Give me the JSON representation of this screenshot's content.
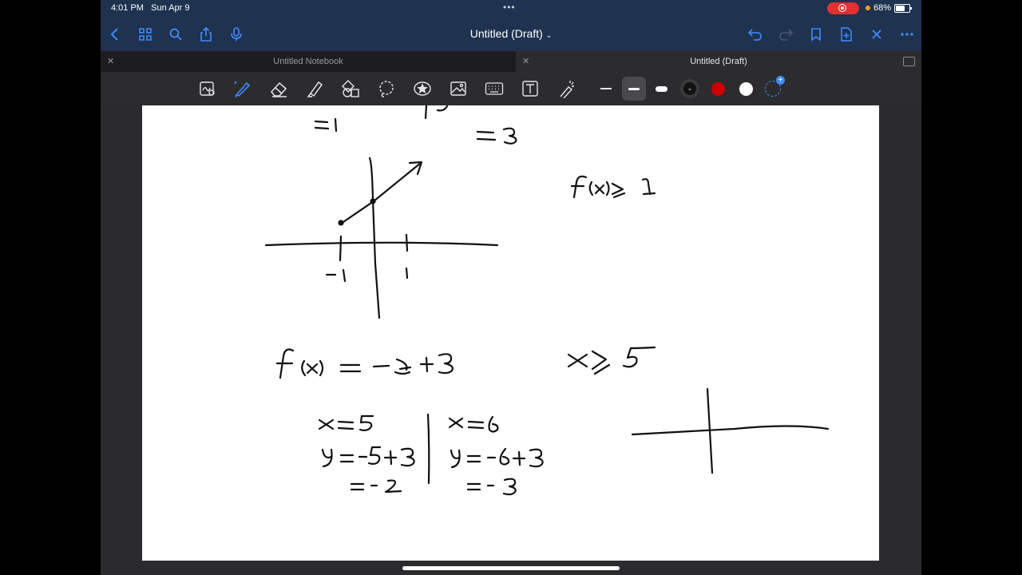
{
  "status_bar": {
    "time": "4:01 PM",
    "date": "Sun Apr 9",
    "battery": "68%"
  },
  "nav": {
    "title": "Untitled (Draft)",
    "icons": [
      "back-icon",
      "grid-icon",
      "search-icon",
      "share-icon",
      "mic-icon",
      "undo-icon",
      "redo-icon",
      "bookmark-icon",
      "add-page-icon",
      "close-icon",
      "more-icon"
    ]
  },
  "tabs": [
    {
      "label": "Untitled Notebook",
      "active": false
    },
    {
      "label": "Untitled (Draft)",
      "active": true
    }
  ],
  "toolbar": {
    "tools": [
      "zoom-lasso-icon",
      "pen-icon",
      "eraser-icon",
      "highlighter-icon",
      "shapes-icon",
      "lasso-icon",
      "sticker-icon",
      "image-icon",
      "keyboard-icon",
      "text-icon",
      "laser-pointer-icon"
    ],
    "colors": [
      "#111111",
      "#cc0000",
      "#ffffff"
    ],
    "accent": "#3f8cff"
  },
  "notes": {
    "text": [
      "=1",
      "=3",
      "-1",
      "1",
      "f(x)≥1",
      "f(x) = -x+3",
      "x≥5",
      "x=5",
      "y=-5+3",
      "=-2",
      "x=6",
      "y=-6+3",
      "=-3"
    ]
  }
}
